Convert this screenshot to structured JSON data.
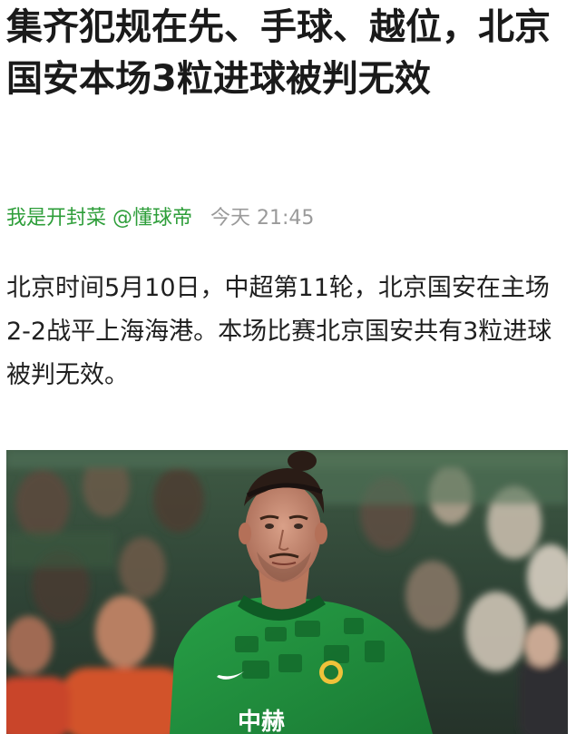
{
  "article": {
    "title": "集齐犯规在先、手球、越位，北京国安本场3粒进球被判无效",
    "author": "我是开封菜 @懂球帝",
    "time": "今天 21:45",
    "body": "北京时间5月10日，中超第11轮，北京国安在主场2-2战平上海海港。本场比赛北京国安共有3粒进球被判无效。"
  },
  "photo": {
    "subject": "green-jersey-player",
    "jersey_color": "#1f8a3c",
    "shirt_sponsor_text": "中赫"
  },
  "colors": {
    "author": "#2e9e3a",
    "time": "#9a9a9a",
    "title": "#1a1a1a"
  }
}
